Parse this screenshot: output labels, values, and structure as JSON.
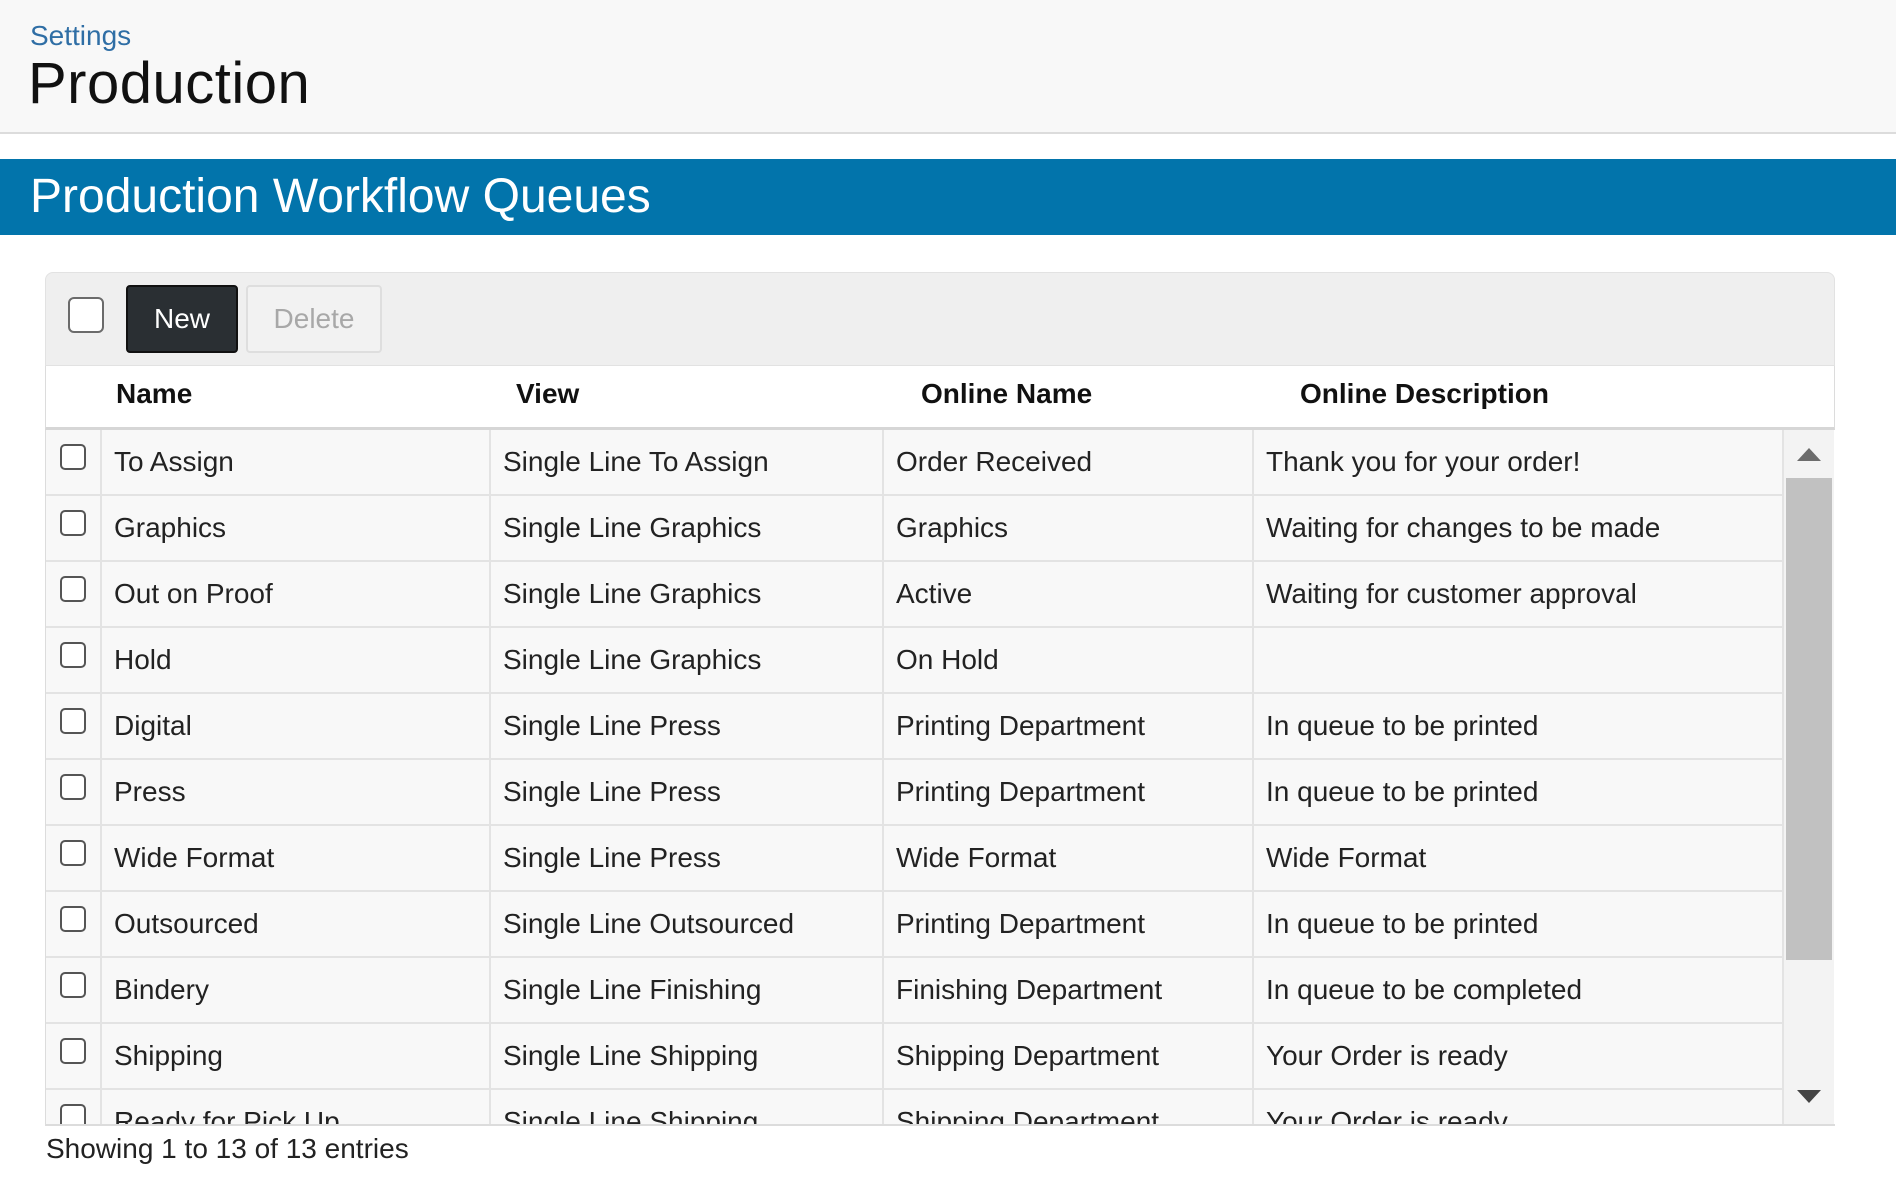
{
  "header": {
    "breadcrumb": "Settings",
    "title": "Production"
  },
  "section": {
    "title": "Production Workflow Queues"
  },
  "toolbar": {
    "new_label": "New",
    "delete_label": "Delete"
  },
  "table": {
    "columns": [
      "Name",
      "View",
      "Online Name",
      "Online Description"
    ],
    "rows": [
      {
        "name": "To Assign",
        "view": "Single Line To Assign",
        "online_name": "Order Received",
        "online_description": "Thank you for your order!"
      },
      {
        "name": "Graphics",
        "view": "Single Line Graphics",
        "online_name": "Graphics",
        "online_description": "Waiting for changes to be made"
      },
      {
        "name": "Out on Proof",
        "view": "Single Line Graphics",
        "online_name": "Active",
        "online_description": "Waiting for customer approval"
      },
      {
        "name": "Hold",
        "view": "Single Line Graphics",
        "online_name": "On Hold",
        "online_description": ""
      },
      {
        "name": "Digital",
        "view": "Single Line Press",
        "online_name": "Printing Department",
        "online_description": "In queue to be printed"
      },
      {
        "name": "Press",
        "view": "Single Line Press",
        "online_name": "Printing Department",
        "online_description": "In queue to be printed"
      },
      {
        "name": "Wide Format",
        "view": "Single Line Press",
        "online_name": "Wide Format",
        "online_description": "Wide Format"
      },
      {
        "name": "Outsourced",
        "view": "Single Line Outsourced",
        "online_name": "Printing Department",
        "online_description": "In queue to be printed"
      },
      {
        "name": "Bindery",
        "view": "Single Line Finishing",
        "online_name": "Finishing Department",
        "online_description": "In queue to be completed"
      },
      {
        "name": "Shipping",
        "view": "Single Line Shipping",
        "online_name": "Shipping Department",
        "online_description": "Your Order is ready"
      },
      {
        "name": "Ready for Pick Up",
        "view": "Single Line Shipping",
        "online_name": "Shipping Department",
        "online_description": "Your Order is ready"
      }
    ]
  },
  "footer": {
    "entries_info": "Showing 1 to 13 of 13 entries"
  },
  "colors": {
    "banner": "#0274ab",
    "breadcrumb": "#2f6ea5",
    "new_button": "#2a2f33"
  }
}
